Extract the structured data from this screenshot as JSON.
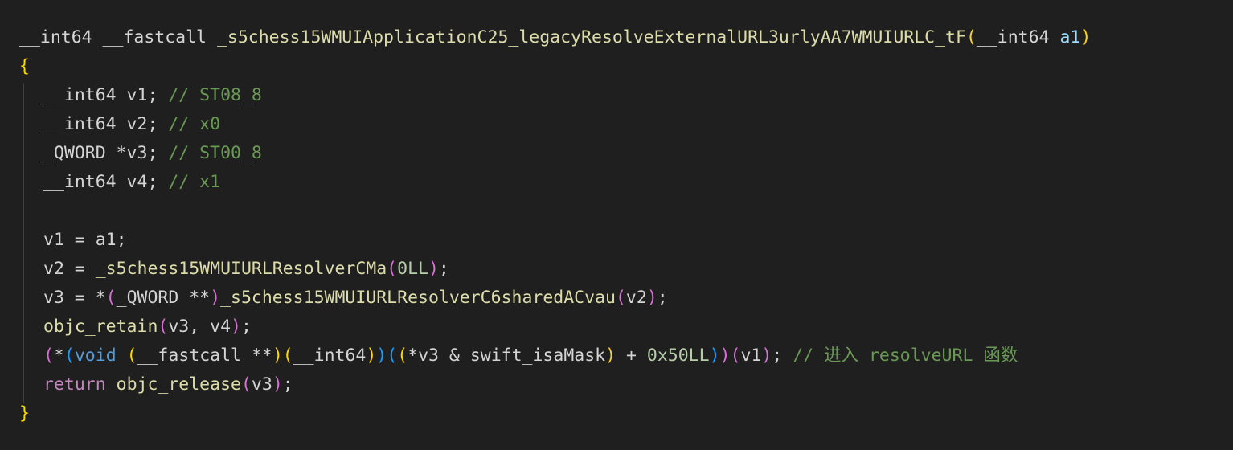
{
  "colors": {
    "default": "#d4d4d4",
    "keyword_type": "#d4d4d4",
    "function": "#dcdcaa",
    "parameter": "#9cdcfe",
    "comment": "#6a9955",
    "brace_yellow": "#ffd700",
    "brace_pink": "#da70d6",
    "brace_blue": "#179fff",
    "control_keyword": "#c586c0",
    "storage_keyword": "#569cd6",
    "number": "#b5cea8"
  },
  "lines": [
    {
      "indent": false,
      "tokens": [
        {
          "text": "__int64 __fastcall ",
          "color": "#d4d4d4"
        },
        {
          "text": "_s5chess15WMUIApplicationC25_legacyResolveExternalURL3urlyAA7WMUIURLC_tF",
          "color": "#dcdcaa"
        },
        {
          "text": "(",
          "color": "#ffd700"
        },
        {
          "text": "__int64 ",
          "color": "#d4d4d4"
        },
        {
          "text": "a1",
          "color": "#9cdcfe"
        },
        {
          "text": ")",
          "color": "#ffd700"
        }
      ]
    },
    {
      "indent": false,
      "tokens": [
        {
          "text": "{",
          "color": "#ffd700"
        }
      ]
    },
    {
      "indent": true,
      "tokens": [
        {
          "text": "__int64 v1; ",
          "color": "#d4d4d4"
        },
        {
          "text": "// ST08_8",
          "color": "#6a9955"
        }
      ]
    },
    {
      "indent": true,
      "tokens": [
        {
          "text": "__int64 v2; ",
          "color": "#d4d4d4"
        },
        {
          "text": "// x0",
          "color": "#6a9955"
        }
      ]
    },
    {
      "indent": true,
      "tokens": [
        {
          "text": "_QWORD *v3; ",
          "color": "#d4d4d4"
        },
        {
          "text": "// ST00_8",
          "color": "#6a9955"
        }
      ]
    },
    {
      "indent": true,
      "tokens": [
        {
          "text": "__int64 v4; ",
          "color": "#d4d4d4"
        },
        {
          "text": "// x1",
          "color": "#6a9955"
        }
      ]
    },
    {
      "indent": true,
      "tokens": []
    },
    {
      "indent": true,
      "tokens": [
        {
          "text": "v1 = a1;",
          "color": "#d4d4d4"
        }
      ]
    },
    {
      "indent": true,
      "tokens": [
        {
          "text": "v2 = ",
          "color": "#d4d4d4"
        },
        {
          "text": "_s5chess15WMUIURLResolverCMa",
          "color": "#dcdcaa"
        },
        {
          "text": "(",
          "color": "#da70d6"
        },
        {
          "text": "0LL",
          "color": "#b5cea8"
        },
        {
          "text": ")",
          "color": "#da70d6"
        },
        {
          "text": ";",
          "color": "#d4d4d4"
        }
      ]
    },
    {
      "indent": true,
      "tokens": [
        {
          "text": "v3 = *",
          "color": "#d4d4d4"
        },
        {
          "text": "(",
          "color": "#da70d6"
        },
        {
          "text": "_QWORD **",
          "color": "#d4d4d4"
        },
        {
          "text": ")",
          "color": "#da70d6"
        },
        {
          "text": "_s5chess15WMUIURLResolverC6sharedACvau",
          "color": "#dcdcaa"
        },
        {
          "text": "(",
          "color": "#da70d6"
        },
        {
          "text": "v2",
          "color": "#d4d4d4"
        },
        {
          "text": ")",
          "color": "#da70d6"
        },
        {
          "text": ";",
          "color": "#d4d4d4"
        }
      ]
    },
    {
      "indent": true,
      "tokens": [
        {
          "text": "objc_retain",
          "color": "#dcdcaa"
        },
        {
          "text": "(",
          "color": "#da70d6"
        },
        {
          "text": "v3, v4",
          "color": "#d4d4d4"
        },
        {
          "text": ")",
          "color": "#da70d6"
        },
        {
          "text": ";",
          "color": "#d4d4d4"
        }
      ]
    },
    {
      "indent": true,
      "tokens": [
        {
          "text": "(",
          "color": "#da70d6"
        },
        {
          "text": "*",
          "color": "#d4d4d4"
        },
        {
          "text": "(",
          "color": "#179fff"
        },
        {
          "text": "void",
          "color": "#569cd6"
        },
        {
          "text": " ",
          "color": "#d4d4d4"
        },
        {
          "text": "(",
          "color": "#ffd700"
        },
        {
          "text": "__fastcall **",
          "color": "#d4d4d4"
        },
        {
          "text": ")",
          "color": "#ffd700"
        },
        {
          "text": "(",
          "color": "#ffd700"
        },
        {
          "text": "__int64",
          "color": "#d4d4d4"
        },
        {
          "text": ")",
          "color": "#ffd700"
        },
        {
          "text": ")",
          "color": "#179fff"
        },
        {
          "text": "(",
          "color": "#179fff"
        },
        {
          "text": "(",
          "color": "#ffd700"
        },
        {
          "text": "*v3 & swift_isaMask",
          "color": "#d4d4d4"
        },
        {
          "text": ")",
          "color": "#ffd700"
        },
        {
          "text": " + ",
          "color": "#d4d4d4"
        },
        {
          "text": "0x50LL",
          "color": "#b5cea8"
        },
        {
          "text": ")",
          "color": "#179fff"
        },
        {
          "text": ")",
          "color": "#da70d6"
        },
        {
          "text": "(",
          "color": "#da70d6"
        },
        {
          "text": "v1",
          "color": "#d4d4d4"
        },
        {
          "text": ")",
          "color": "#da70d6"
        },
        {
          "text": "; ",
          "color": "#d4d4d4"
        },
        {
          "text": "// 进入 resolveURL 函数",
          "color": "#6a9955"
        }
      ]
    },
    {
      "indent": true,
      "tokens": [
        {
          "text": "return",
          "color": "#c586c0"
        },
        {
          "text": " ",
          "color": "#d4d4d4"
        },
        {
          "text": "objc_release",
          "color": "#dcdcaa"
        },
        {
          "text": "(",
          "color": "#da70d6"
        },
        {
          "text": "v3",
          "color": "#d4d4d4"
        },
        {
          "text": ")",
          "color": "#da70d6"
        },
        {
          "text": ";",
          "color": "#d4d4d4"
        }
      ]
    },
    {
      "indent": false,
      "tokens": [
        {
          "text": "}",
          "color": "#ffd700"
        }
      ]
    }
  ]
}
